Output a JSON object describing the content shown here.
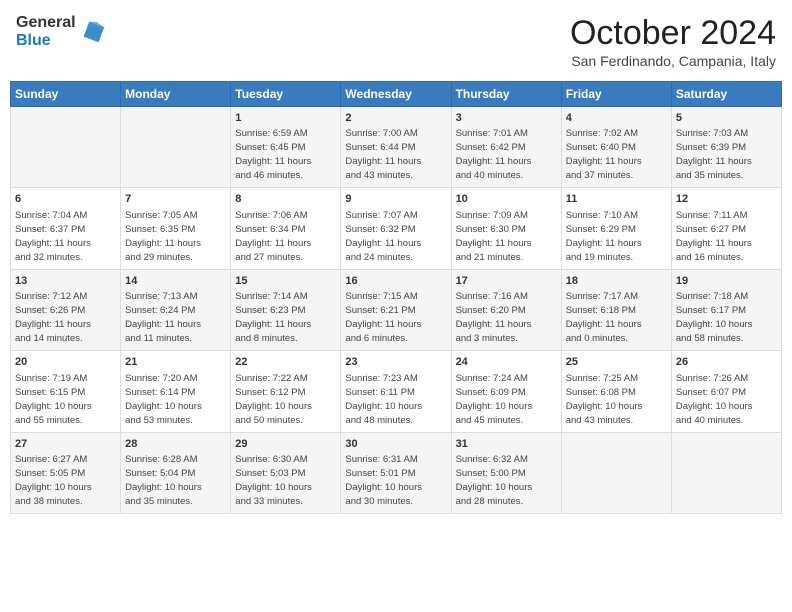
{
  "header": {
    "logo_general": "General",
    "logo_blue": "Blue",
    "month_title": "October 2024",
    "location": "San Ferdinando, Campania, Italy"
  },
  "days_of_week": [
    "Sunday",
    "Monday",
    "Tuesday",
    "Wednesday",
    "Thursday",
    "Friday",
    "Saturday"
  ],
  "weeks": [
    [
      {
        "day": "",
        "info": ""
      },
      {
        "day": "",
        "info": ""
      },
      {
        "day": "1",
        "info": "Sunrise: 6:59 AM\nSunset: 6:45 PM\nDaylight: 11 hours\nand 46 minutes."
      },
      {
        "day": "2",
        "info": "Sunrise: 7:00 AM\nSunset: 6:44 PM\nDaylight: 11 hours\nand 43 minutes."
      },
      {
        "day": "3",
        "info": "Sunrise: 7:01 AM\nSunset: 6:42 PM\nDaylight: 11 hours\nand 40 minutes."
      },
      {
        "day": "4",
        "info": "Sunrise: 7:02 AM\nSunset: 6:40 PM\nDaylight: 11 hours\nand 37 minutes."
      },
      {
        "day": "5",
        "info": "Sunrise: 7:03 AM\nSunset: 6:39 PM\nDaylight: 11 hours\nand 35 minutes."
      }
    ],
    [
      {
        "day": "6",
        "info": "Sunrise: 7:04 AM\nSunset: 6:37 PM\nDaylight: 11 hours\nand 32 minutes."
      },
      {
        "day": "7",
        "info": "Sunrise: 7:05 AM\nSunset: 6:35 PM\nDaylight: 11 hours\nand 29 minutes."
      },
      {
        "day": "8",
        "info": "Sunrise: 7:06 AM\nSunset: 6:34 PM\nDaylight: 11 hours\nand 27 minutes."
      },
      {
        "day": "9",
        "info": "Sunrise: 7:07 AM\nSunset: 6:32 PM\nDaylight: 11 hours\nand 24 minutes."
      },
      {
        "day": "10",
        "info": "Sunrise: 7:09 AM\nSunset: 6:30 PM\nDaylight: 11 hours\nand 21 minutes."
      },
      {
        "day": "11",
        "info": "Sunrise: 7:10 AM\nSunset: 6:29 PM\nDaylight: 11 hours\nand 19 minutes."
      },
      {
        "day": "12",
        "info": "Sunrise: 7:11 AM\nSunset: 6:27 PM\nDaylight: 11 hours\nand 16 minutes."
      }
    ],
    [
      {
        "day": "13",
        "info": "Sunrise: 7:12 AM\nSunset: 6:26 PM\nDaylight: 11 hours\nand 14 minutes."
      },
      {
        "day": "14",
        "info": "Sunrise: 7:13 AM\nSunset: 6:24 PM\nDaylight: 11 hours\nand 11 minutes."
      },
      {
        "day": "15",
        "info": "Sunrise: 7:14 AM\nSunset: 6:23 PM\nDaylight: 11 hours\nand 8 minutes."
      },
      {
        "day": "16",
        "info": "Sunrise: 7:15 AM\nSunset: 6:21 PM\nDaylight: 11 hours\nand 6 minutes."
      },
      {
        "day": "17",
        "info": "Sunrise: 7:16 AM\nSunset: 6:20 PM\nDaylight: 11 hours\nand 3 minutes."
      },
      {
        "day": "18",
        "info": "Sunrise: 7:17 AM\nSunset: 6:18 PM\nDaylight: 11 hours\nand 0 minutes."
      },
      {
        "day": "19",
        "info": "Sunrise: 7:18 AM\nSunset: 6:17 PM\nDaylight: 10 hours\nand 58 minutes."
      }
    ],
    [
      {
        "day": "20",
        "info": "Sunrise: 7:19 AM\nSunset: 6:15 PM\nDaylight: 10 hours\nand 55 minutes."
      },
      {
        "day": "21",
        "info": "Sunrise: 7:20 AM\nSunset: 6:14 PM\nDaylight: 10 hours\nand 53 minutes."
      },
      {
        "day": "22",
        "info": "Sunrise: 7:22 AM\nSunset: 6:12 PM\nDaylight: 10 hours\nand 50 minutes."
      },
      {
        "day": "23",
        "info": "Sunrise: 7:23 AM\nSunset: 6:11 PM\nDaylight: 10 hours\nand 48 minutes."
      },
      {
        "day": "24",
        "info": "Sunrise: 7:24 AM\nSunset: 6:09 PM\nDaylight: 10 hours\nand 45 minutes."
      },
      {
        "day": "25",
        "info": "Sunrise: 7:25 AM\nSunset: 6:08 PM\nDaylight: 10 hours\nand 43 minutes."
      },
      {
        "day": "26",
        "info": "Sunrise: 7:26 AM\nSunset: 6:07 PM\nDaylight: 10 hours\nand 40 minutes."
      }
    ],
    [
      {
        "day": "27",
        "info": "Sunrise: 6:27 AM\nSunset: 5:05 PM\nDaylight: 10 hours\nand 38 minutes."
      },
      {
        "day": "28",
        "info": "Sunrise: 6:28 AM\nSunset: 5:04 PM\nDaylight: 10 hours\nand 35 minutes."
      },
      {
        "day": "29",
        "info": "Sunrise: 6:30 AM\nSunset: 5:03 PM\nDaylight: 10 hours\nand 33 minutes."
      },
      {
        "day": "30",
        "info": "Sunrise: 6:31 AM\nSunset: 5:01 PM\nDaylight: 10 hours\nand 30 minutes."
      },
      {
        "day": "31",
        "info": "Sunrise: 6:32 AM\nSunset: 5:00 PM\nDaylight: 10 hours\nand 28 minutes."
      },
      {
        "day": "",
        "info": ""
      },
      {
        "day": "",
        "info": ""
      }
    ]
  ]
}
